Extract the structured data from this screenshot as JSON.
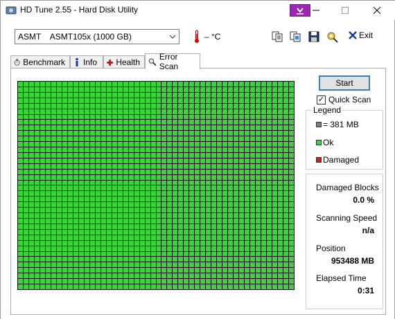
{
  "window": {
    "title": "HD Tune 2.55 - Hard Disk Utility"
  },
  "toolbar": {
    "drive": "ASMT    ASMT105x (1000 GB)",
    "temperature": "– °C",
    "exit_label": "Exit"
  },
  "tabs": [
    {
      "label": "Benchmark",
      "icon": "stopwatch-icon"
    },
    {
      "label": "Info",
      "icon": "info-icon"
    },
    {
      "label": "Health",
      "icon": "cross-icon"
    },
    {
      "label": "Error Scan",
      "icon": "magnifier-icon",
      "active": true
    }
  ],
  "scan": {
    "start_label": "Start",
    "quick_scan_label": "Quick Scan",
    "quick_scan_checked": true,
    "block_color": "#3cd43c",
    "block_columns": 50,
    "block_rows": 38
  },
  "legend": {
    "title": "Legend",
    "items": [
      {
        "label": "= 381 MB",
        "color": "#808080"
      },
      {
        "label": "Ok",
        "color": "#3cd43c"
      },
      {
        "label": "Damaged",
        "color": "#cc2222"
      }
    ]
  },
  "stats": {
    "damaged_blocks_label": "Damaged Blocks",
    "damaged_blocks_value": "0.0 %",
    "scanning_speed_label": "Scanning Speed",
    "scanning_speed_value": "n/a",
    "position_label": "Position",
    "position_value": "953488 MB",
    "elapsed_label": "Elapsed Time",
    "elapsed_value": "0:31"
  }
}
